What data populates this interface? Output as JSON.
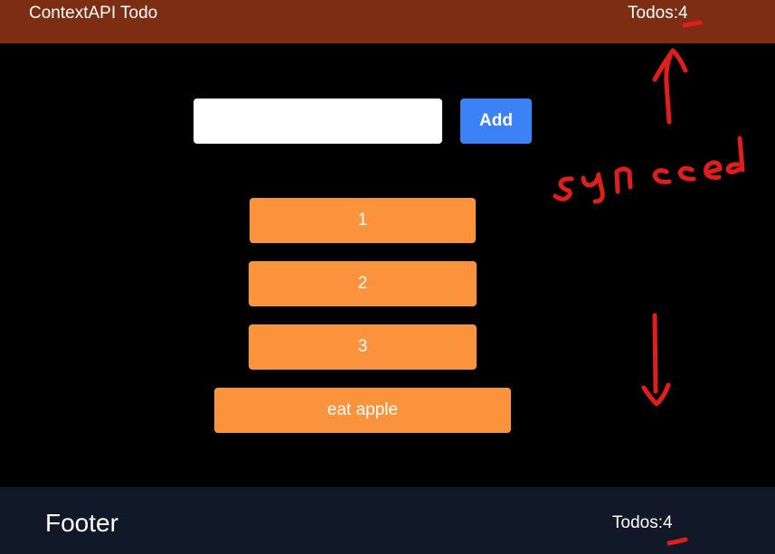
{
  "header": {
    "title": "ContextAPI Todo",
    "todo_count": "Todos:4"
  },
  "form": {
    "input_value": "",
    "placeholder": "",
    "add_label": "Add"
  },
  "todos": [
    {
      "label": "1"
    },
    {
      "label": "2"
    },
    {
      "label": "3"
    },
    {
      "label": "eat apple"
    }
  ],
  "footer": {
    "title": "Footer",
    "todo_count": "Todos:4"
  },
  "annotation": {
    "text": "synced"
  },
  "colors": {
    "header_bg": "#7c2d12",
    "footer_bg": "#111827",
    "accent": "#3b82f6",
    "todo_bg": "#fb923c",
    "annotation": "#e11d1d"
  }
}
